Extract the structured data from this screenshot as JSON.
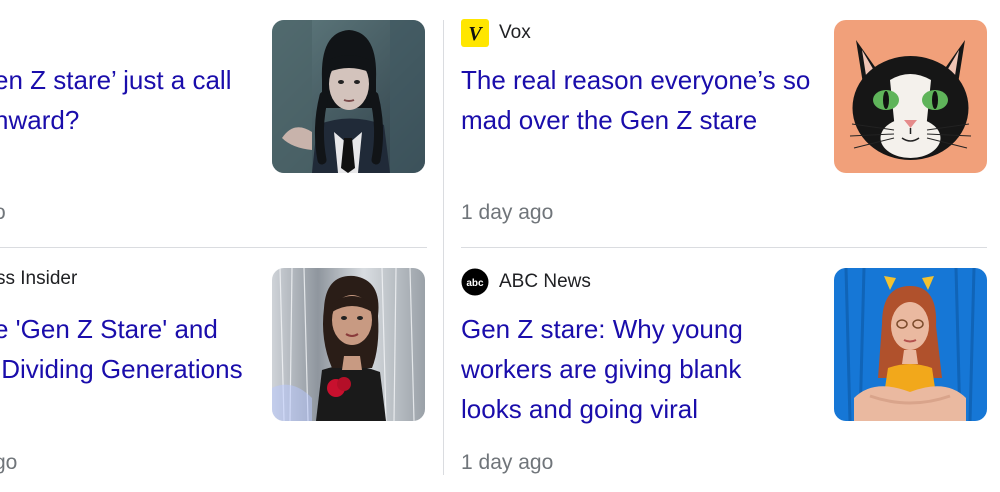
{
  "articles": [
    {
      "source": "",
      "headline": "en Z stare’ just a call\nnward?",
      "time": "o"
    },
    {
      "source": "Vox",
      "headline": "The real reason everyone’s so\nmad over the Gen Z stare",
      "time": "1 day ago",
      "favicon_text": "V",
      "favicon_bg": "#ffe600"
    },
    {
      "source": "ss Insider",
      "headline": "e 'Gen Z Stare' and\n Dividing Generations",
      "time": "go"
    },
    {
      "source": "ABC News",
      "headline": "Gen Z stare: Why young\nworkers are giving blank\nlooks and going viral",
      "time": "1 day ago",
      "favicon_text": "abc",
      "favicon_bg": "#000000"
    }
  ],
  "colors": {
    "headline": "#1a0dab",
    "timestamp": "#70757a",
    "divider": "#dadce0"
  }
}
